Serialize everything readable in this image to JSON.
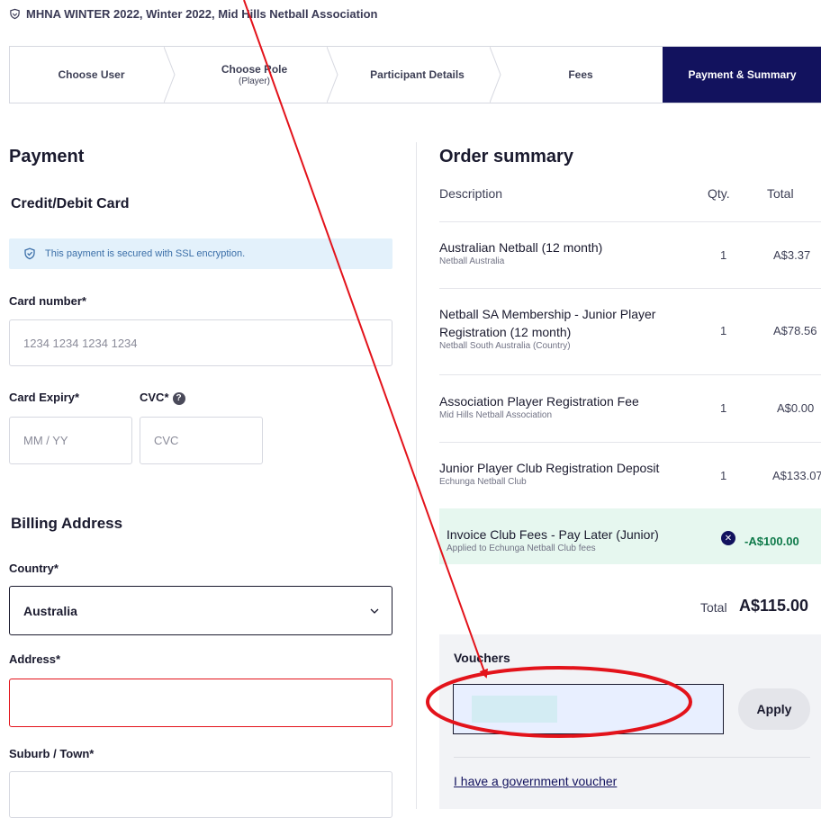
{
  "header": {
    "breadcrumb": "MHNA WINTER 2022, Winter 2022, Mid Hills Netball Association"
  },
  "steps": [
    {
      "label": "Choose User",
      "sub": ""
    },
    {
      "label": "Choose Role",
      "sub": "(Player)"
    },
    {
      "label": "Participant Details",
      "sub": ""
    },
    {
      "label": "Fees",
      "sub": ""
    },
    {
      "label": "Payment & Summary",
      "sub": ""
    }
  ],
  "payment": {
    "title": "Payment",
    "method_title": "Credit/Debit Card",
    "ssl_notice": "This payment is secured with SSL encryption.",
    "card_number_label": "Card number*",
    "card_number_placeholder": "1234 1234 1234 1234",
    "expiry_label": "Card Expiry*",
    "expiry_placeholder": "MM / YY",
    "cvc_label": "CVC*",
    "cvc_help": "?",
    "cvc_placeholder": "CVC",
    "billing_title": "Billing Address",
    "country_label": "Country*",
    "country_value": "Australia",
    "address_label": "Address*",
    "suburb_label": "Suburb / Town*"
  },
  "summary": {
    "title": "Order summary",
    "col_description": "Description",
    "col_qty": "Qty.",
    "col_total": "Total",
    "items": [
      {
        "title": "Australian Netball (12 month)",
        "sub": "Netball Australia",
        "qty": "1",
        "amount": "A$3.37"
      },
      {
        "title": "Netball SA Membership - Junior Player",
        "title2": "Registration (12 month)",
        "sub": "Netball South Australia (Country)",
        "qty": "1",
        "amount": "A$78.56"
      },
      {
        "title": "Association Player Registration Fee",
        "sub": "Mid Hills Netball Association",
        "qty": "1",
        "amount": "A$0.00"
      },
      {
        "title": "Junior Player Club Registration Deposit",
        "sub": "Echunga Netball Club",
        "qty": "1",
        "amount": "A$133.07"
      }
    ],
    "discount": {
      "title": "Invoice Club Fees - Pay Later (Junior)",
      "sub": "Applied to Echunga Netball Club fees",
      "amount": "-A$100.00"
    },
    "total_label": "Total",
    "total_value": "A$115.00",
    "vouchers_title": "Vouchers",
    "apply_label": "Apply",
    "gov_voucher_link": "I have a government voucher"
  },
  "colors": {
    "primary": "#12125e",
    "annotation": "#e3131b",
    "discount_bg": "#e6f7ef",
    "ssl_bg": "#e3f1fb"
  }
}
